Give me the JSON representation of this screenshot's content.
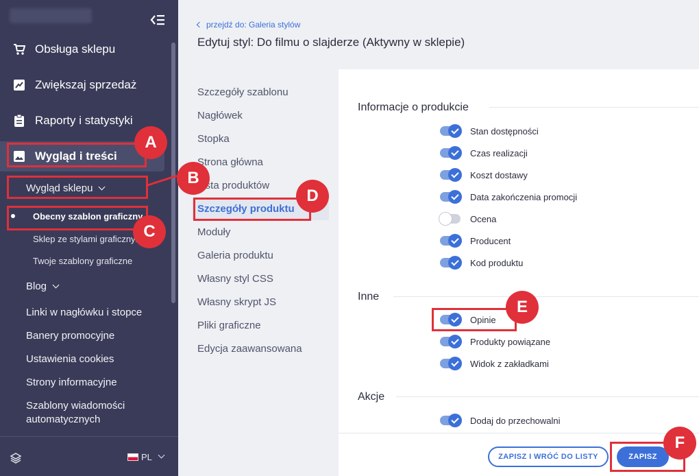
{
  "sidebar": {
    "menu": [
      {
        "label": "Obsługa sklepu",
        "icon": "cart-icon"
      },
      {
        "label": "Zwiększaj sprzedaż",
        "icon": "chart-icon"
      },
      {
        "label": "Raporty i statystyki",
        "icon": "clipboard-icon"
      },
      {
        "label": "Wygląd i treści",
        "icon": "image-icon",
        "active": true
      }
    ],
    "submenu_title": "Wygląd sklepu",
    "subitems": [
      "Obecny szablon graficzny",
      "Sklep ze stylami graficznymi",
      "Twoje szablony graficzne"
    ],
    "other_items": [
      "Blog",
      "Linki w nagłówku i stopce",
      "Banery promocyjne",
      "Ustawienia cookies",
      "Strony informacyjne",
      "Szablony wiadomości",
      "automatycznych"
    ],
    "language": "PL"
  },
  "header": {
    "back_link": "przejdź do: Galeria stylów",
    "title": "Edytuj styl: Do filmu o slajderze (Aktywny w sklepie)"
  },
  "tabs": [
    "Szczegóły szablonu",
    "Nagłówek",
    "Stopka",
    "Strona główna",
    "Lista produktów",
    "Szczegóły produktu",
    "Moduły",
    "Galeria produktu",
    "Własny styl CSS",
    "Własny skrypt JS",
    "Pliki graficzne",
    "Edycja zaawansowana"
  ],
  "panel": {
    "sections": [
      {
        "title": "Informacje o produkcie",
        "options": [
          {
            "label": "Stan dostępności",
            "on": true
          },
          {
            "label": "Czas realizacji",
            "on": true
          },
          {
            "label": "Koszt dostawy",
            "on": true
          },
          {
            "label": "Data zakończenia promocji",
            "on": true
          },
          {
            "label": "Ocena",
            "on": false
          },
          {
            "label": "Producent",
            "on": true
          },
          {
            "label": "Kod produktu",
            "on": true
          }
        ]
      },
      {
        "title": "Inne",
        "options": [
          {
            "label": "Opinie",
            "on": true
          },
          {
            "label": "Produkty powiązane",
            "on": true
          },
          {
            "label": "Widok z zakładkami",
            "on": true
          }
        ]
      },
      {
        "title": "Akcje",
        "options": [
          {
            "label": "Dodaj do przechowalni",
            "on": true
          }
        ]
      }
    ],
    "buttons": {
      "save_return": "ZAPISZ I WRÓĆ DO LISTY",
      "save": "ZAPISZ"
    }
  },
  "markers": [
    "A",
    "B",
    "C",
    "D",
    "E",
    "F"
  ],
  "colors": {
    "sidebar_bg": "#3a3b58",
    "accent": "#3c70d8",
    "annotation": "#e0303a"
  }
}
